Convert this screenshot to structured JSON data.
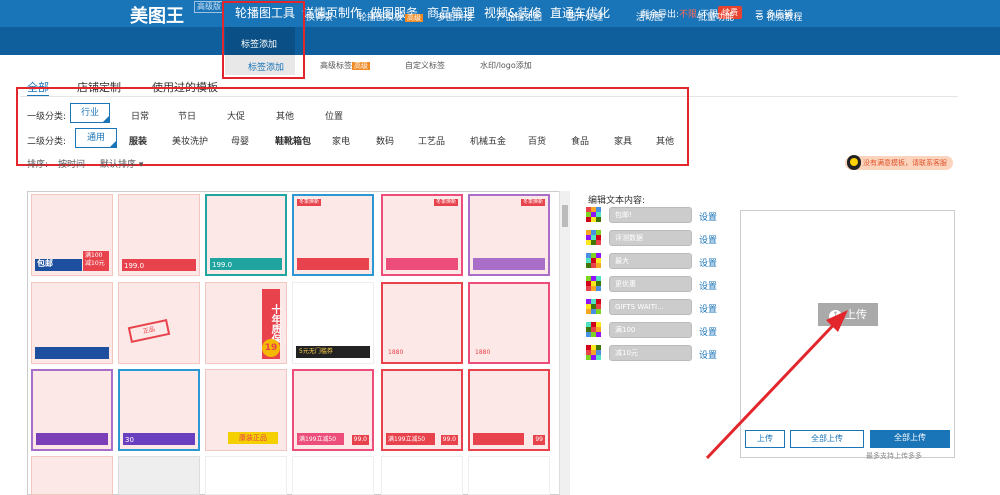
{
  "app": {
    "logo": "美图王",
    "version": "高级版"
  },
  "nav": {
    "items": [
      "轮播图工具",
      "详情页制作",
      "做图服务",
      "商品管理",
      "视频&装修",
      "直通车优化"
    ]
  },
  "account": {
    "remaining_label": "剩余导出:",
    "remaining_value": "不限",
    "unlimited": "/不限",
    "renew": "续费",
    "store": "多店铺"
  },
  "subnav": {
    "items": [
      "换背景",
      "轮播图模板",
      "多图拼接",
      "产品描述图",
      "图片处理",
      "活动图",
      "批量功能",
      "视频教程"
    ],
    "badge": "高级"
  },
  "dropdown": {
    "item1": "标签添加",
    "item2": "标签添加"
  },
  "subnav2": {
    "items": [
      "高级标签",
      "自定义标签",
      "水印/logo添加"
    ],
    "badge": "高级"
  },
  "tabs": {
    "all": "全部",
    "store": "店铺定制",
    "used": "使用过的模板"
  },
  "filters": {
    "level1_label": "一级分类:",
    "level1": [
      "行业",
      "日常",
      "节日",
      "大促",
      "其他",
      "位置"
    ],
    "level2_label": "二级分类:",
    "level2": [
      "通用",
      "服装",
      "美妆洗护",
      "母婴",
      "鞋靴箱包",
      "家电",
      "数码",
      "工艺品",
      "机械五金",
      "百货",
      "食品",
      "家具",
      "其他"
    ],
    "sort_label": "排序:",
    "sort_time": "按时间",
    "sort_default": "默认排序"
  },
  "hint": "没有满意模板，请联系客服",
  "tiles": {
    "t1_main": "包邮",
    "t1_price": "满100减10元",
    "t2_price": "199.0",
    "t3_price": "199.0",
    "t4_badge": "冬季焕新",
    "t5_badge": "冬季焕新",
    "t6_badge": "冬季焕新",
    "vbanner": "十年质保",
    "vnum": "19",
    "stamp": "正品",
    "promo": "5元无门槛券",
    "p1": "1880",
    "p2": "1880",
    "gen": "康装正品",
    "r1": "满199立减50",
    "r2": "99.0",
    "r3": "满199立减50",
    "r4": "99.0",
    "r5": "99",
    "n30": "30"
  },
  "editor": {
    "title": "编辑文本内容:",
    "fields": [
      "包邮!",
      "评测数据",
      "最大",
      "更优惠",
      "GIFTS WAITI...",
      "满100",
      "减10元"
    ],
    "set": "设置"
  },
  "upload": {
    "label": "上传",
    "btn1": "上传",
    "btn2": "全部上传",
    "btn3": "全部上传",
    "tip": "最多支持上传多多"
  },
  "colors": {
    "primary": "#1a74b8",
    "accent": "#e8434c",
    "highlight": "#e3262b"
  }
}
